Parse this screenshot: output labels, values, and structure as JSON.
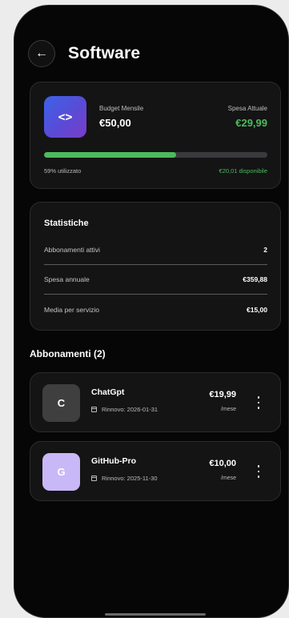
{
  "header": {
    "title": "Software",
    "back_icon": "arrow-left-icon"
  },
  "budget": {
    "icon": "code-brackets-icon",
    "icon_glyph": "<>",
    "budget_label": "Budget Mensile",
    "budget_value": "€50,00",
    "spent_label": "Spesa Attuale",
    "spent_value": "€29,99",
    "usage_text": "59% utilizzato",
    "usage_percent": 59,
    "available_text": "€20,01 disponibile",
    "accent_color": "#4cbb5c"
  },
  "stats": {
    "title": "Statistiche",
    "rows": [
      {
        "label": "Abbonamenti attivi",
        "value": "2"
      },
      {
        "label": "Spesa annuale",
        "value": "€359,88"
      },
      {
        "label": "Media per servizio",
        "value": "€15,00"
      }
    ]
  },
  "subscriptions": {
    "title": "Abbonamenti (2)",
    "items": [
      {
        "initial": "C",
        "icon_color": "#3f3f3f",
        "name": "ChatGpt",
        "renew": "Rinnovo: 2026-01-31",
        "price": "€19,99",
        "period": "/mese"
      },
      {
        "initial": "G",
        "icon_color": "#c9b8f7",
        "name": "GitHub-Pro",
        "renew": "Rinnovo: 2025-11-30",
        "price": "€10,00",
        "period": "/mese"
      }
    ]
  }
}
